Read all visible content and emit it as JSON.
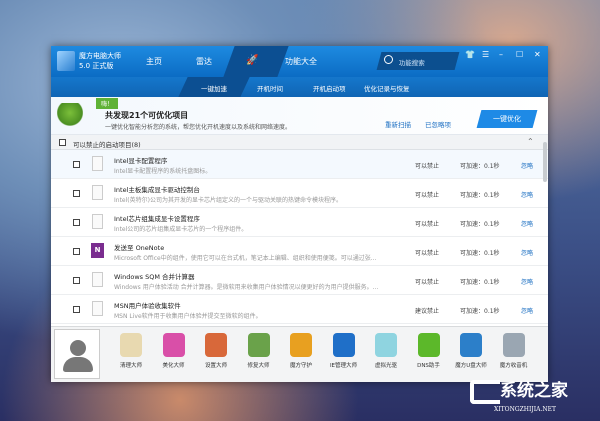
{
  "app": {
    "name": "魔方电脑大师",
    "version": "5.0 正式版"
  },
  "tabs": [
    "主页",
    "雷达",
    "功能大全"
  ],
  "search_placeholder": "功能搜索",
  "subtabs": [
    "一键加速",
    "开机时间",
    "开机启动项",
    "优化记录与恢复"
  ],
  "banner": {
    "bubble": "嗨！",
    "title": "共发现21个可优化项目",
    "desc": "一键优化智能分析您的系统，帮您优化开机速度以及系统和网络速度。",
    "rescan": "重新扫描",
    "ignored": "已忽略项",
    "optimize": "一键优化"
  },
  "list": {
    "header": "可以禁止的启动项目(8)",
    "rows": [
      {
        "title": "Intel显卡配置程序",
        "desc": "Intel显卡配置程序的系统托盘图标。",
        "status": "可以禁止",
        "speed": "可加速：0.1秒",
        "action": "忽略",
        "icon": "file"
      },
      {
        "title": "Intel主板集成显卡驱动控制台",
        "desc": "Intel(英特尔)公司为其开发的显卡芯片组定义的一个与驱动关联的热键命令模块程序。",
        "status": "可以禁止",
        "speed": "可加速：0.1秒",
        "action": "忽略",
        "icon": "file"
      },
      {
        "title": "Intel芯片组集成显卡设置程序",
        "desc": "Intel公司的芯片组集成显卡芯片的一个程序组件。",
        "status": "可以禁止",
        "speed": "可加速：0.1秒",
        "action": "忽略",
        "icon": "file"
      },
      {
        "title": "发送至 OneNote",
        "desc": "Microsoft Office中的组件，使用它可以在台式机，笔记本上编辑、组织和使用便笺。可以通过张...",
        "status": "可以禁止",
        "speed": "可加速：0.1秒",
        "action": "忽略",
        "icon": "onenote"
      },
      {
        "title": "Windows SQM 合并计算器",
        "desc": "Windows 用户体验活动 合并计算器。是微软用来收集用户体验情况以便更好的为用户提供服务。...",
        "status": "可以禁止",
        "speed": "可加速：0.1秒",
        "action": "忽略",
        "icon": "file"
      },
      {
        "title": "MSN用户体验收集软件",
        "desc": "MSN Live软件用于收集用户体验并提交至微软的组件。",
        "status": "建议禁止",
        "speed": "可加速：0.1秒",
        "action": "忽略",
        "icon": "file"
      }
    ]
  },
  "tools": [
    {
      "label": "清理大师",
      "color": "#e8d9b0"
    },
    {
      "label": "美化大师",
      "color": "#d94fa8"
    },
    {
      "label": "设置大师",
      "color": "#d8683a"
    },
    {
      "label": "修复大师",
      "color": "#6aa24a"
    },
    {
      "label": "魔方守护",
      "color": "#e8a020"
    },
    {
      "label": "IE管理大师",
      "color": "#1f6fc8"
    },
    {
      "label": "虚拟光驱",
      "color": "#8fd4e0"
    },
    {
      "label": "DNS助手",
      "color": "#5cb82a"
    },
    {
      "label": "魔方U盘大师",
      "color": "#2c7fc9"
    },
    {
      "label": "魔方收音机",
      "color": "#9aa6b2"
    }
  ],
  "watermark": {
    "title": "系统之家",
    "url": "XITONGZHIJIA.NET"
  }
}
